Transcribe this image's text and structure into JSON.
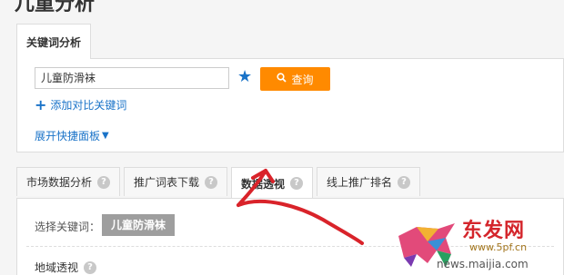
{
  "page": {
    "title": "儿童分析"
  },
  "keyword_card": {
    "tab_label": "关键词分析",
    "search_value": "儿童防滑袜",
    "query_label": "查询",
    "add_compare_label": "添加对比关键词",
    "expand_panel_label": "展开快捷面板"
  },
  "tabs": [
    {
      "label": "市场数据分析"
    },
    {
      "label": "推广词表下载"
    },
    {
      "label": "数据透视"
    },
    {
      "label": "线上推广排名"
    }
  ],
  "content": {
    "select_keyword_label": "选择关键词：",
    "selected_keyword": "儿童防滑袜",
    "region_label": "地域透视"
  },
  "icons": {
    "star": "star-icon",
    "search": "search-icon",
    "help": "question-icon",
    "add": "plus-icon",
    "caret": "caret-down-icon"
  },
  "colors": {
    "accent_orange": "#ff8a00",
    "link_blue": "#1a73c8",
    "annotation_red": "#d9232a"
  },
  "watermark": {
    "brand": "东发网",
    "url": "www.5pf.cn",
    "url2": "news.maijia.com"
  }
}
